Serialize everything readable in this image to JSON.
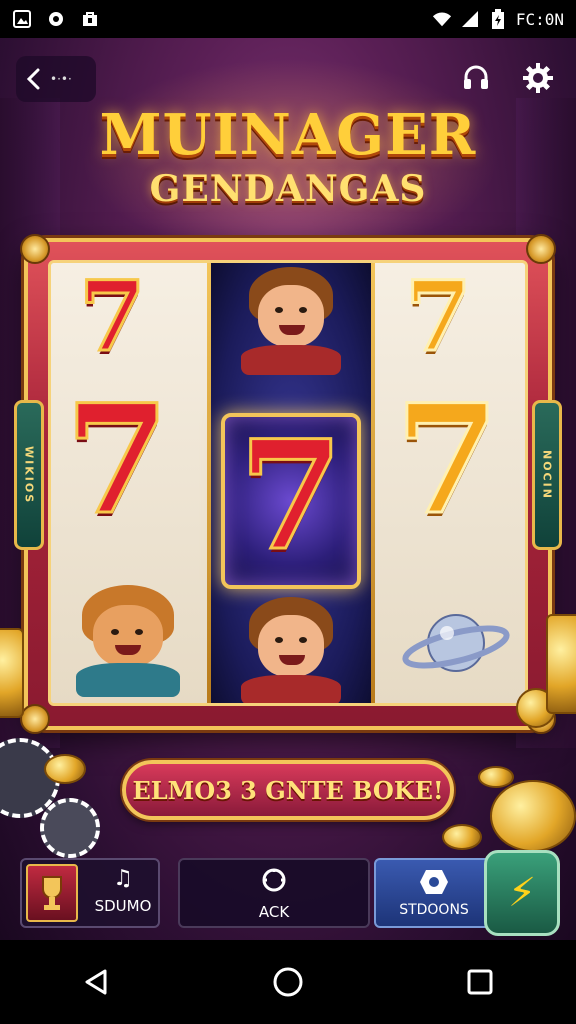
{
  "status_bar": {
    "icons": [
      "photo-icon",
      "settings-app-icon",
      "store-icon"
    ],
    "right_icons": [
      "wifi-icon",
      "signal-icon",
      "battery-icon"
    ],
    "time_text": "FC:0N"
  },
  "header": {
    "back_label": "•·•·",
    "title_line_1": "MUINAGER",
    "title_line_2": "GENDANGAS",
    "icons": [
      "headset-icon",
      "gear-icon"
    ]
  },
  "machine": {
    "left_tab_text": "WIKIOS",
    "right_tab_text": "NOCIN",
    "reels": [
      [
        "red-seven",
        "red-seven",
        "cat-character"
      ],
      [
        "hero-character",
        "red-seven",
        "hero-character"
      ],
      [
        "gold-seven",
        "gold-seven",
        "planet"
      ]
    ],
    "symbol_glyph": "7"
  },
  "banner": {
    "label": "ELMO3 3 GNTE BOKE!"
  },
  "controls": {
    "sound": {
      "label": "SDUMO",
      "glyph": "♫"
    },
    "ack": {
      "label": "ACK"
    },
    "stdoons": {
      "label": "STDOONS"
    },
    "bolt": {
      "glyph": "⚡"
    }
  },
  "colors": {
    "accent_gold": "#f3c55a",
    "frame_red": "#a8243a",
    "background_purple": "#5a1f55"
  }
}
